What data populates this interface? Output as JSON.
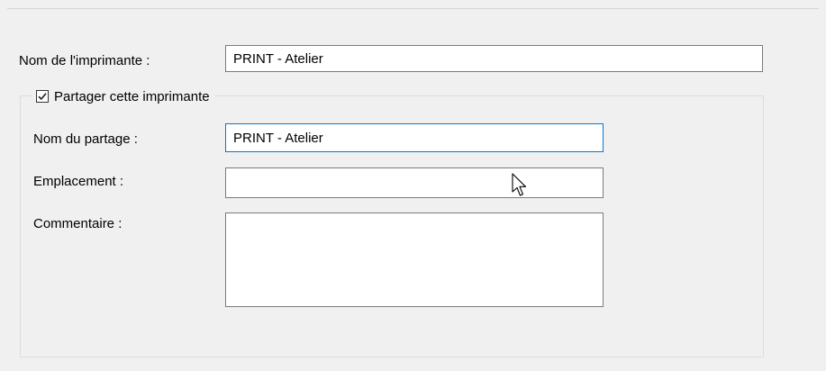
{
  "printer": {
    "name_label": "Nom de l'imprimante :",
    "name_value": "PRINT - Atelier"
  },
  "sharing": {
    "checkbox_label": "Partager cette imprimante",
    "checked": true,
    "share_name_label": "Nom du partage :",
    "share_name_value": "PRINT - Atelier",
    "location_label": "Emplacement :",
    "location_value": "",
    "comment_label": "Commentaire :",
    "comment_value": ""
  },
  "icons": {
    "checkbox": "checkmark-icon",
    "cursor": "mouse-pointer-icon"
  },
  "colors": {
    "focus_border": "#0078d7",
    "field_border": "#7a7a7a",
    "background": "#f0f0f0"
  }
}
